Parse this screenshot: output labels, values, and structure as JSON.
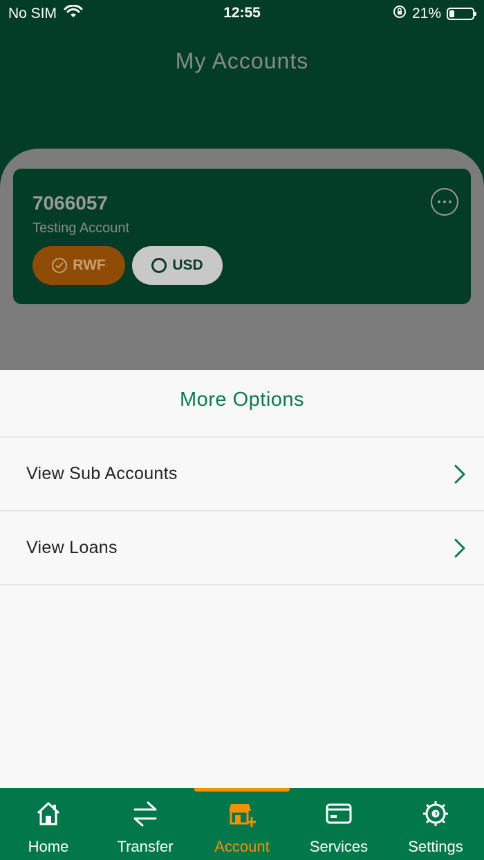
{
  "status": {
    "carrier": "No SIM",
    "time": "12:55",
    "battery": "21%"
  },
  "header": {
    "title": "My Accounts"
  },
  "account": {
    "number": "7066057",
    "name": "Testing Account",
    "currencies": [
      {
        "label": "RWF",
        "selected": true
      },
      {
        "label": "USD",
        "selected": false
      }
    ]
  },
  "sheet": {
    "title": "More Options",
    "options": [
      {
        "label": "View Sub Accounts"
      },
      {
        "label": "View Loans"
      }
    ]
  },
  "tabs": [
    {
      "label": "Home",
      "icon": "home-icon"
    },
    {
      "label": "Transfer",
      "icon": "transfer-icon"
    },
    {
      "label": "Account",
      "icon": "account-icon",
      "active": true
    },
    {
      "label": "Services",
      "icon": "card-icon"
    },
    {
      "label": "Settings",
      "icon": "gear-icon"
    }
  ],
  "colors": {
    "brand": "#02784a",
    "dark": "#033c27",
    "accent": "#f39200"
  }
}
